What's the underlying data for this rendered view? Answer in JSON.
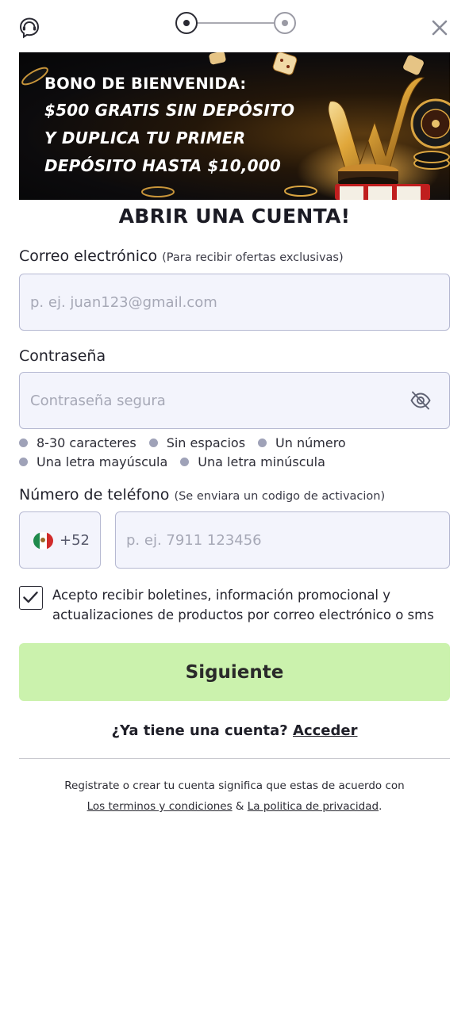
{
  "header": {
    "support_icon": "headset-icon",
    "close_icon": "close-icon",
    "steps": {
      "current": 1,
      "total": 2
    }
  },
  "banner": {
    "line1": "BONO DE BIENVENIDA:",
    "line2": "$500 GRATIS SIN DEPÓSITO",
    "line3": "Y DUPLICA TU PRIMER",
    "line4": "DEPÓSITO HASTA $10,000"
  },
  "form": {
    "title": "ABRIR UNA CUENTA!",
    "email": {
      "label": "Correo electrónico",
      "hint": "(Para recibir ofertas exclusivas)",
      "placeholder": "p. ej. juan123@gmail.com",
      "value": ""
    },
    "password": {
      "label": "Contraseña",
      "placeholder": "Contraseña segura",
      "value": "",
      "toggle_icon": "eye-off-icon",
      "rules": [
        "8-30 caracteres",
        "Sin espacios",
        "Un número",
        "Una letra mayúscula",
        "Una letra minúscula"
      ]
    },
    "phone": {
      "label": "Número de teléfono",
      "hint": "(Se enviara un codigo de activacion)",
      "country_flag": "mexico-flag-icon",
      "dial_code": "+52",
      "placeholder": "p. ej. 7911 123456",
      "value": ""
    },
    "consent": {
      "checked": true,
      "text": "Acepto recibir boletines, información promocional y actualizaciones de productos por correo electrónico o sms"
    },
    "submit_label": "Siguiente"
  },
  "footer": {
    "have_account": "¿Ya tiene una cuenta?",
    "login_link": "Acceder",
    "legal_text": "Registrate o crear tu cuenta significa que estas de acuerdo con",
    "terms_link": "Los terminos y condiciones",
    "connector": "&",
    "privacy_link": "La politica de privacidad",
    "end": "."
  },
  "colors": {
    "submit_bg": "#cbf2ad",
    "input_bg": "#f3f4fc",
    "input_border": "#b6b9d2",
    "rule_dot": "#9fa2b8"
  }
}
